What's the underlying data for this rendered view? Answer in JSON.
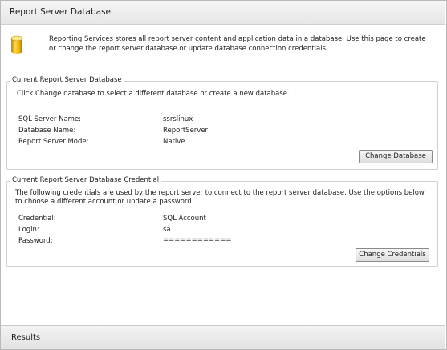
{
  "header": {
    "title": "Report Server Database"
  },
  "intro": {
    "icon": "database-icon",
    "text": "Reporting Services stores all report server content and application data in a database. Use this page to create or change the report server database or update database connection credentials."
  },
  "database_group": {
    "legend": "Current Report Server Database",
    "description": "Click Change database to select a different database or create a new database.",
    "rows": [
      {
        "label": "SQL Server Name:",
        "value": "ssrslinux"
      },
      {
        "label": "Database Name:",
        "value": "ReportServer"
      },
      {
        "label": "Report Server Mode:",
        "value": "Native"
      }
    ],
    "button_label": "Change Database"
  },
  "credential_group": {
    "legend": "Current Report Server Database Credential",
    "description": "The following credentials are used by the report server to connect to the report server database.  Use the options below to choose a different account or update a password.",
    "rows": [
      {
        "label": "Credential:",
        "value": "SQL Account"
      },
      {
        "label": "Login:",
        "value": "sa"
      },
      {
        "label": "Password:",
        "value": "============"
      }
    ],
    "button_label": "Change Credentials"
  },
  "results": {
    "title": "Results"
  }
}
